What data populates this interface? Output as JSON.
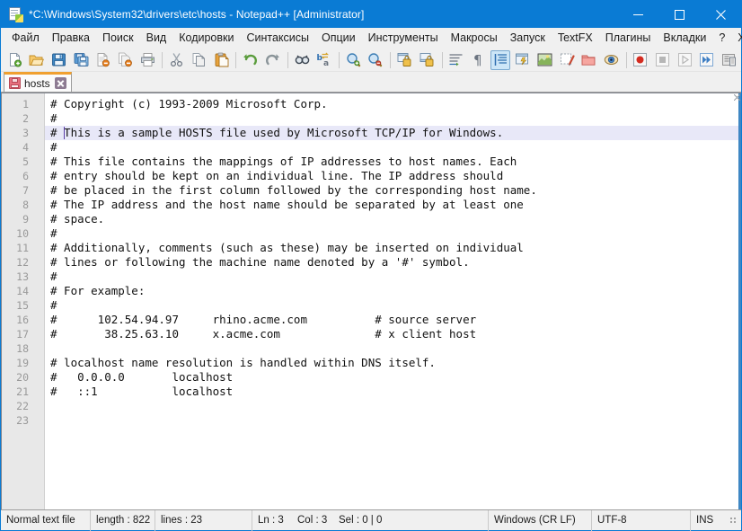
{
  "window": {
    "title": "*C:\\Windows\\System32\\drivers\\etc\\hosts - Notepad++ [Administrator]",
    "app_icon": "notepad-plus-plus-icon",
    "titlebar_color": "#0a7bd4",
    "controls": {
      "minimize": "minimize-icon",
      "maximize": "maximize-icon",
      "close": "close-icon"
    }
  },
  "menubar": {
    "items": [
      {
        "label": "Файл",
        "name": "menu-file"
      },
      {
        "label": "Правка",
        "name": "menu-edit"
      },
      {
        "label": "Поиск",
        "name": "menu-search"
      },
      {
        "label": "Вид",
        "name": "menu-view"
      },
      {
        "label": "Кодировки",
        "name": "menu-encoding"
      },
      {
        "label": "Синтаксисы",
        "name": "menu-language"
      },
      {
        "label": "Опции",
        "name": "menu-settings"
      },
      {
        "label": "Инструменты",
        "name": "menu-tools"
      },
      {
        "label": "Макросы",
        "name": "menu-macro"
      },
      {
        "label": "Запуск",
        "name": "menu-run"
      },
      {
        "label": "TextFX",
        "name": "menu-textfx"
      },
      {
        "label": "Плагины",
        "name": "menu-plugins"
      },
      {
        "label": "Вкладки",
        "name": "menu-window"
      },
      {
        "label": "?",
        "name": "menu-help"
      }
    ],
    "close_doc_label": "X"
  },
  "toolbar": {
    "buttons": [
      {
        "name": "new-file-icon",
        "tooltip": "Новый"
      },
      {
        "name": "open-file-icon",
        "tooltip": "Открыть"
      },
      {
        "name": "save-icon",
        "tooltip": "Сохранить"
      },
      {
        "name": "save-all-icon",
        "tooltip": "Сохранить все"
      },
      {
        "name": "close-file-icon",
        "tooltip": "Закрыть"
      },
      {
        "name": "close-all-files-icon",
        "tooltip": "Закрыть все"
      },
      {
        "name": "print-icon",
        "tooltip": "Печать"
      },
      {
        "name": "separator-1"
      },
      {
        "name": "cut-icon",
        "tooltip": "Вырезать"
      },
      {
        "name": "copy-icon",
        "tooltip": "Копировать"
      },
      {
        "name": "paste-icon",
        "tooltip": "Вставить"
      },
      {
        "name": "separator-2"
      },
      {
        "name": "undo-icon",
        "tooltip": "Отменить"
      },
      {
        "name": "redo-icon",
        "tooltip": "Повторить"
      },
      {
        "name": "separator-3"
      },
      {
        "name": "find-icon",
        "tooltip": "Найти"
      },
      {
        "name": "replace-icon",
        "tooltip": "Заменить"
      },
      {
        "name": "separator-4"
      },
      {
        "name": "zoom-in-icon",
        "tooltip": "Увеличить"
      },
      {
        "name": "zoom-out-icon",
        "tooltip": "Уменьшить"
      },
      {
        "name": "separator-5"
      },
      {
        "name": "sync-vertical-scroll-icon",
        "tooltip": "Синхронная вертикальная прокрутка"
      },
      {
        "name": "sync-horizontal-scroll-icon",
        "tooltip": "Синхронная горизонтальная прокрутка"
      },
      {
        "name": "separator-6"
      },
      {
        "name": "word-wrap-icon",
        "tooltip": "Перенос строк"
      },
      {
        "name": "show-all-characters-icon",
        "tooltip": "Отображать все символы"
      },
      {
        "name": "show-indent-guide-icon",
        "tooltip": "Показать направляющие отступов",
        "active": true
      },
      {
        "name": "user-defined-dialog-icon",
        "tooltip": "Пользовательский синтаксис"
      },
      {
        "name": "document-map-icon",
        "tooltip": "Карта документа"
      },
      {
        "name": "function-list-icon",
        "tooltip": "Список функций"
      },
      {
        "name": "folder-as-workspace-icon",
        "tooltip": "Папка как рабочее пространство"
      },
      {
        "name": "monitoring-icon",
        "tooltip": "Мониторинг"
      },
      {
        "name": "separator-7"
      },
      {
        "name": "record-macro-icon",
        "tooltip": "Начать запись"
      },
      {
        "name": "stop-macro-icon",
        "tooltip": "Остановить запись"
      },
      {
        "name": "play-macro-icon",
        "tooltip": "Воспроизвести"
      },
      {
        "name": "run-macro-multiple-icon",
        "tooltip": "Выполнить несколько раз"
      },
      {
        "name": "save-macro-icon",
        "tooltip": "Сохранить макрос"
      }
    ]
  },
  "tabs": [
    {
      "label": "hosts",
      "icon": "unsaved-save-icon",
      "active": true,
      "close": "close-tab-icon"
    }
  ],
  "editor": {
    "current_line": 3,
    "caret": {
      "line": 3,
      "column": 3
    },
    "lines": [
      {
        "n": "1",
        "text": "# Copyright (c) 1993-2009 Microsoft Corp."
      },
      {
        "n": "2",
        "text": "#"
      },
      {
        "n": "3",
        "text": "# This is a sample HOSTS file used by Microsoft TCP/IP for Windows."
      },
      {
        "n": "4",
        "text": "#"
      },
      {
        "n": "5",
        "text": "# This file contains the mappings of IP addresses to host names. Each"
      },
      {
        "n": "6",
        "text": "# entry should be kept on an individual line. The IP address should"
      },
      {
        "n": "7",
        "text": "# be placed in the first column followed by the corresponding host name."
      },
      {
        "n": "8",
        "text": "# The IP address and the host name should be separated by at least one"
      },
      {
        "n": "9",
        "text": "# space."
      },
      {
        "n": "10",
        "text": "#"
      },
      {
        "n": "11",
        "text": "# Additionally, comments (such as these) may be inserted on individual"
      },
      {
        "n": "12",
        "text": "# lines or following the machine name denoted by a '#' symbol."
      },
      {
        "n": "13",
        "text": "#"
      },
      {
        "n": "14",
        "text": "# For example:"
      },
      {
        "n": "15",
        "text": "#"
      },
      {
        "n": "16",
        "text": "#      102.54.94.97     rhino.acme.com          # source server"
      },
      {
        "n": "17",
        "text": "#       38.25.63.10     x.acme.com              # x client host"
      },
      {
        "n": "18",
        "text": ""
      },
      {
        "n": "19",
        "text": "# localhost name resolution is handled within DNS itself."
      },
      {
        "n": "20",
        "text": "#   0.0.0.0       localhost"
      },
      {
        "n": "21",
        "text": "#   ::1           localhost"
      },
      {
        "n": "22",
        "text": ""
      },
      {
        "n": "23",
        "text": ""
      }
    ]
  },
  "statusbar": {
    "doc_type": "Normal text file",
    "length": "length : 822",
    "lines": "lines : 23",
    "ln": "Ln : 3",
    "col": "Col : 3",
    "sel": "Sel : 0 | 0",
    "eol": "Windows (CR LF)",
    "encoding": "UTF-8",
    "mode": "INS"
  },
  "colors": {
    "titlebar": "#0a7bd4",
    "chrome": "#f0f0f0",
    "gutter": "#e8e8e8",
    "editor_bg": "#ffffff",
    "current_line": "#e8e8f8",
    "tab_active_top": "#f0a030",
    "caret": "#5b3fa8"
  }
}
